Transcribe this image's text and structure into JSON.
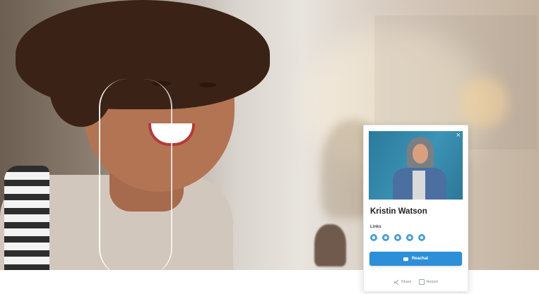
{
  "profile_card": {
    "name": "Kristin Watson",
    "links_label": "Links",
    "cta_label": "Reachat",
    "footer": {
      "share_label": "Share",
      "report_label": "Report"
    }
  },
  "socials": [
    {
      "icon": "globe-icon"
    },
    {
      "icon": "camera-icon"
    },
    {
      "icon": "facebook-icon"
    },
    {
      "icon": "linkedin-icon"
    },
    {
      "icon": "close-icon"
    }
  ],
  "colors": {
    "accent": "#2c8fd8",
    "social": "#4c9fd7"
  }
}
